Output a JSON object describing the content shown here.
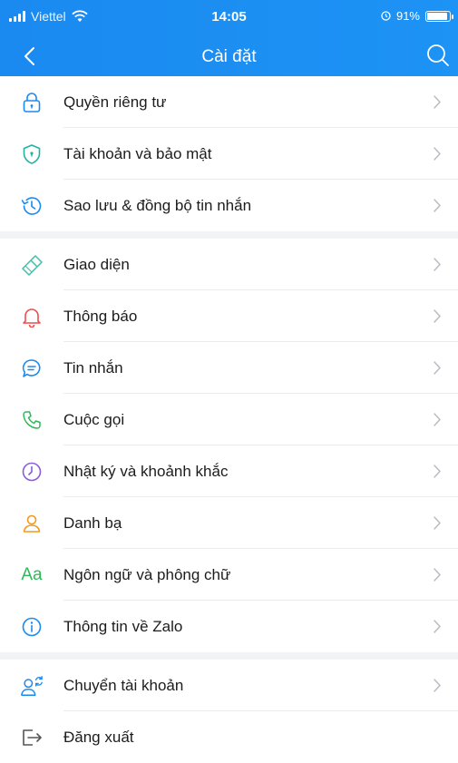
{
  "status_bar": {
    "carrier": "Viettel",
    "time": "14:05",
    "battery_text": "91%",
    "battery_level": 0.91
  },
  "nav": {
    "title": "Cài đặt",
    "back_icon": "chevron-left-icon",
    "search_icon": "search-icon"
  },
  "groups": [
    [
      {
        "label": "Quyền riêng tư",
        "icon": "lock-icon",
        "color": "#1a8af0"
      },
      {
        "label": "Tài khoản và bảo mật",
        "icon": "shield-icon",
        "color": "#1fb5a0"
      },
      {
        "label": "Sao lưu & đồng bộ tin nhắn",
        "icon": "backup-clock-icon",
        "color": "#1a8af0"
      }
    ],
    [
      {
        "label": "Giao diện",
        "icon": "brush-icon",
        "color": "#3fc0a8"
      },
      {
        "label": "Thông báo",
        "icon": "bell-icon",
        "color": "#ee4d4d"
      },
      {
        "label": "Tin nhắn",
        "icon": "chat-icon",
        "color": "#1a8af0"
      },
      {
        "label": "Cuộc gọi",
        "icon": "phone-icon",
        "color": "#2fb85a"
      },
      {
        "label": "Nhật ký và khoảnh khắc",
        "icon": "clock-icon",
        "color": "#8a5cd8"
      },
      {
        "label": "Danh bạ",
        "icon": "contact-icon",
        "color": "#f39a1e"
      },
      {
        "label": "Ngôn ngữ và phông chữ",
        "icon": "font-icon",
        "glyph": "Aa",
        "color": "#2fb85a"
      },
      {
        "label": "Thông tin về Zalo",
        "icon": "info-icon",
        "color": "#1a8af0"
      }
    ],
    [
      {
        "label": "Chuyển tài khoản",
        "icon": "switch-account-icon",
        "color": "#1a8af0"
      },
      {
        "label": "Đăng xuất",
        "icon": "logout-icon",
        "color": "#555555"
      }
    ]
  ]
}
